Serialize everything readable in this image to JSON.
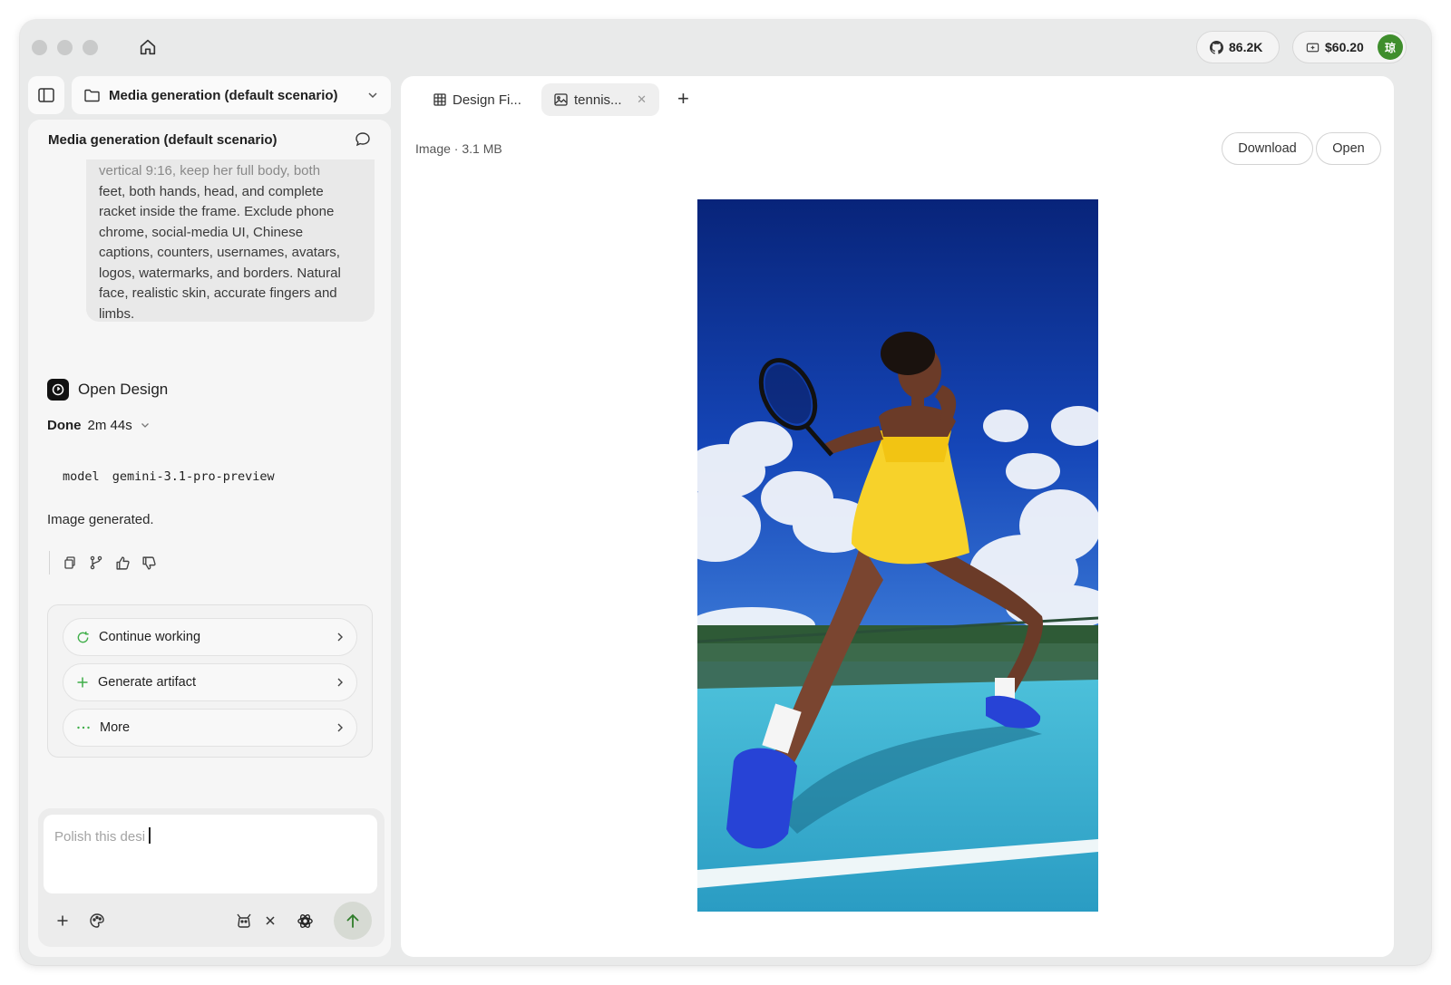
{
  "titlebar": {
    "github_stars": "86.2K",
    "balance": "$60.20",
    "avatar_initial": "琼"
  },
  "project": {
    "name": "Media generation (default scenario)"
  },
  "chat": {
    "header_title": "Media generation (default scenario)",
    "prompt_lines": [
      "vertical 9:16, keep her full body, both",
      "feet, both hands, head, and complete",
      "racket inside the frame. Exclude phone",
      "chrome, social-media UI, Chinese",
      "captions, counters, usernames, avatars,",
      "logos, watermarks, and borders. Natural",
      "face, realistic skin, accurate fingers and",
      "limbs."
    ],
    "agent_name": "Open Design",
    "status_done": "Done",
    "duration": "2m 44s",
    "model_key": "model",
    "model_value": "gemini-3.1-pro-preview",
    "result_text": "Image generated.",
    "suggestions": [
      {
        "label": "Continue working",
        "icon": "refresh-icon"
      },
      {
        "label": "Generate artifact",
        "icon": "plus-icon"
      },
      {
        "label": "More",
        "icon": "dots-icon"
      }
    ],
    "composer_placeholder": "Polish this desi"
  },
  "tabs": [
    {
      "label": "Design Fi...",
      "icon": "grid-icon"
    },
    {
      "label": "tennis...",
      "icon": "image-icon",
      "active": true
    }
  ],
  "viewer": {
    "meta": "Image · 3.1 MB",
    "download_label": "Download",
    "open_label": "Open"
  }
}
